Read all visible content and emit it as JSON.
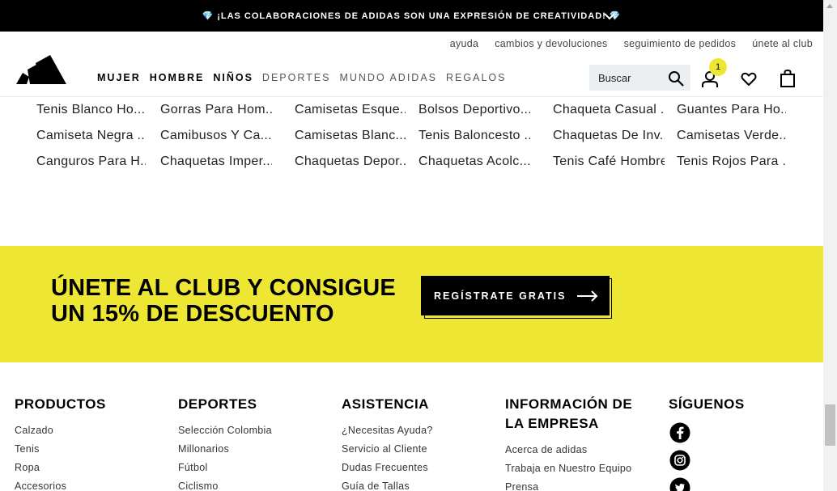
{
  "promo": {
    "text": "¡LAS COLABORACIONES DE ADIDAS SON UNA EXPRESIÓN DE CREATIVIDAD!",
    "left_icon": "diamond-icon",
    "right_icon": "diamond-icon"
  },
  "utility_links": [
    "ayuda",
    "cambios y devoluciones",
    "seguimiento de pedidos",
    "únete al club"
  ],
  "nav": {
    "items": [
      {
        "label": "MUJER",
        "style": "bold"
      },
      {
        "label": "HOMBRE",
        "style": "bold"
      },
      {
        "label": "NIÑOS",
        "style": "bold"
      },
      {
        "label": "DEPORTES",
        "style": "light"
      },
      {
        "label": "MUNDO ADIDAS",
        "style": "light"
      },
      {
        "label": "REGALOS",
        "style": "light"
      }
    ]
  },
  "search": {
    "placeholder": "Buscar"
  },
  "account": {
    "badge_count": "1"
  },
  "product_links": [
    [
      "Tenis Blanco Ho...",
      "Gorras Para Hom...",
      "Camisetas Esque...",
      "Bolsos Deportivo...",
      "Chaqueta Casual ...",
      "Guantes Para Ho..."
    ],
    [
      "Camiseta Negra ...",
      "Camibusos Y Ca...",
      "Camisetas Blanc...",
      "Tenis Baloncesto ...",
      "Chaquetas De Inv...",
      "Camisetas Verde..."
    ],
    [
      "Canguros Para H...",
      "Chaquetas Imper...",
      "Chaquetas Depor...",
      "Chaquetas Acolc...",
      "Tenis Café Hombre",
      "Tenis Rojos Para ..."
    ]
  ],
  "club": {
    "title_line1": "ÚNETE AL CLUB Y CONSIGUE",
    "title_line2": "UN 15% DE DESCUENTO",
    "button": "REGÍSTRATE GRATIS"
  },
  "footer": {
    "columns": [
      {
        "title": "PRODUCTOS",
        "items": [
          "Calzado",
          "Tenis",
          "Ropa",
          "Accesorios"
        ]
      },
      {
        "title": "DEPORTES",
        "items": [
          "Selección Colombia",
          "Millonarios",
          "Fútbol",
          "Ciclismo"
        ]
      },
      {
        "title": "ASISTENCIA",
        "items": [
          "¿Necesitas Ayuda?",
          "Servicio al Cliente",
          "Dudas Frecuentes",
          "Guía de Tallas"
        ]
      },
      {
        "title": "INFORMACIÓN DE LA EMPRESA",
        "items": [
          "Acerca de adidas",
          "Trabaja en Nuestro Equipo",
          "Prensa"
        ]
      },
      {
        "title": "SÍGUENOS",
        "items": []
      }
    ],
    "social": [
      "facebook-icon",
      "instagram-icon",
      "twitter-icon"
    ]
  },
  "colors": {
    "accent": "#ede734",
    "dark": "#000000",
    "diamond": "#7ec8f0"
  }
}
